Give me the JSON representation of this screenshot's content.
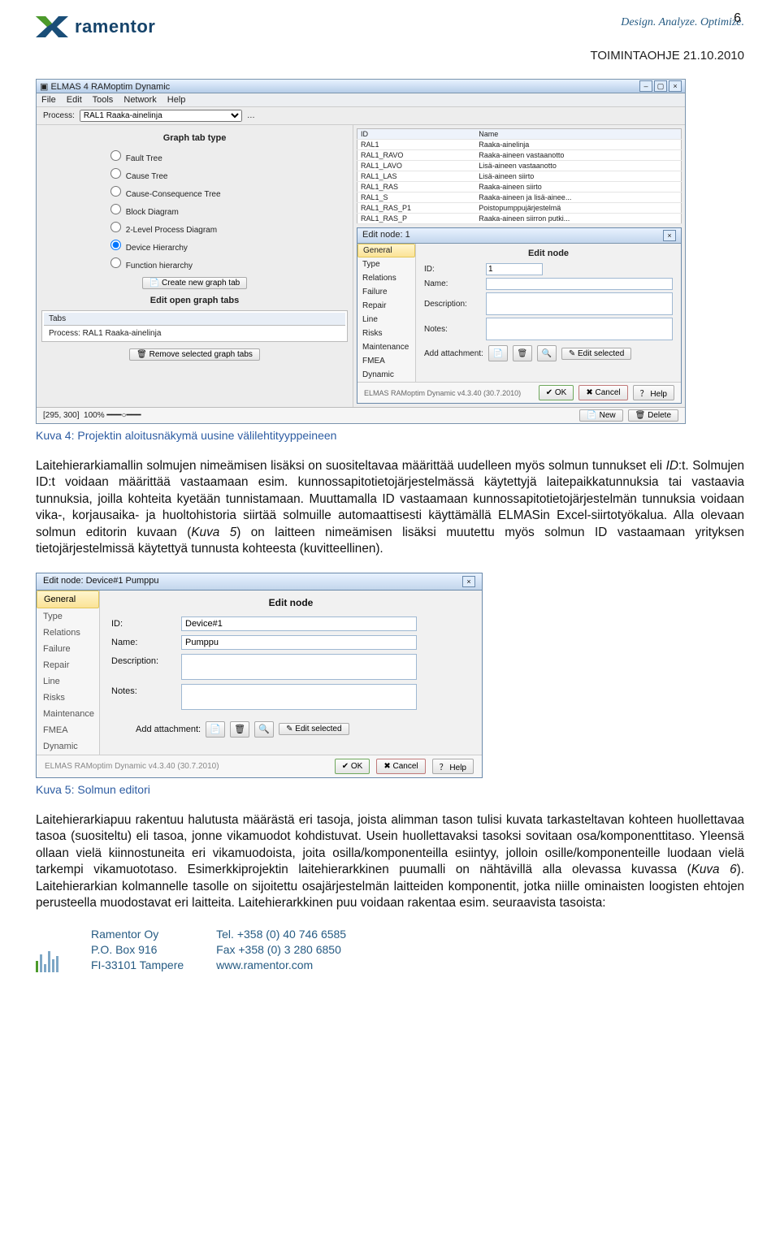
{
  "page_number": "6",
  "brand": {
    "name": "ramentor",
    "tagline": "Design. Analyze. Optimize."
  },
  "header_right": "TOIMINTAOHJE 21.10.2010",
  "app": {
    "title": "ELMAS 4 RAMoptim Dynamic",
    "menu": [
      "File",
      "Edit",
      "Tools",
      "Network",
      "Help"
    ],
    "process_label": "Process:",
    "process_value": "RAL1 Raaka-ainelinja",
    "graph_panel_title": "Graph tab type",
    "radios": [
      "Fault Tree",
      "Cause Tree",
      "Cause-Consequence Tree",
      "Block Diagram",
      "2-Level Process Diagram",
      "Device Hierarchy",
      "Function hierarchy"
    ],
    "radio_selected": 5,
    "create_tab_btn": "Create new graph tab",
    "edit_open_title": "Edit open graph tabs",
    "tabs_header": "Tabs",
    "tabs_row": "Process: RAL1 Raaka-ainelinja",
    "remove_tabs_btn": "Remove selected graph tabs",
    "id_table_headers": [
      "ID",
      "Name"
    ],
    "id_table_rows": [
      [
        "RAL1",
        "Raaka-ainelinja"
      ],
      [
        "RAL1_RAVO",
        "Raaka-aineen vastaanotto"
      ],
      [
        "RAL1_LAVO",
        "Lisä-aineen vastaanotto"
      ],
      [
        "RAL1_LAS",
        "Lisä-aineen siirto"
      ],
      [
        "RAL1_RAS",
        "Raaka-aineen siirto"
      ],
      [
        "RAL1_S",
        "Raaka-aineen ja lisä-ainee..."
      ],
      [
        "RAL1_RAS_P1",
        "Poistopumppujärjestelmä"
      ],
      [
        "RAL1_RAS_P",
        "Raaka-aineen siirron putki..."
      ]
    ],
    "edit_node": {
      "win_title": "Edit node: 1",
      "tabs": [
        "General",
        "Type",
        "Relations",
        "Failure",
        "Repair",
        "Line",
        "Risks",
        "Maintenance",
        "FMEA",
        "Dynamic"
      ],
      "heading": "Edit node",
      "id_label": "ID:",
      "id_val": "1",
      "name_label": "Name:",
      "desc_label": "Description:",
      "notes_label": "Notes:",
      "attach_label": "Add attachment:",
      "edit_selected": "Edit selected",
      "ver": "ELMAS RAMoptim Dynamic v4.3.40 (30.7.2010)",
      "ok": "OK",
      "cancel": "Cancel",
      "help": "Help"
    },
    "status_coord": "[295, 300]",
    "status_zoom": "100%",
    "status_new": "New",
    "status_delete": "Delete"
  },
  "caption1": "Kuva 4: Projektin aloitusnäkymä uusine välilehtityyppeineen",
  "para1": "Laitehierarkiamallin solmujen nimeämisen lisäksi on suositeltavaa määrittää uudelleen myös solmun tunnukset eli ID:t. Solmujen ID:t voidaan määrittää vastaamaan esim. kunnossapitotietojärjestelmässä käytettyjä laitepaikkatunnuksia tai vastaavia tunnuksia, joilla kohteita kyetään tunnistamaan. Muuttamalla ID vastaamaan kunnossapitotietojärjestelmän tunnuksia voidaan vika-, korjausaika- ja huoltohistoria siirtää solmuille automaattisesti käyttämällä ELMASin Excel-siirtotyökalua. Alla olevaan solmun editorin kuvaan (Kuva 5) on laitteen nimeämisen lisäksi muutettu myös solmun ID vastaamaan yrityksen tietojärjestelmissä käytettyä tunnusta kohteesta (kuvitteellinen).",
  "edit2": {
    "title": "Edit node: Device#1 Pumppu",
    "tabs": [
      "General",
      "Type",
      "Relations",
      "Failure",
      "Repair",
      "Line",
      "Risks",
      "Maintenance",
      "FMEA",
      "Dynamic"
    ],
    "heading": "Edit node",
    "id_label": "ID:",
    "id_val": "Device#1",
    "name_label": "Name:",
    "name_val": "Pumppu",
    "desc_label": "Description:",
    "notes_label": "Notes:",
    "attach_label": "Add attachment:",
    "edit_selected": "Edit selected",
    "ver": "ELMAS RAMoptim Dynamic v4.3.40 (30.7.2010)",
    "ok": "OK",
    "cancel": "Cancel",
    "help": "Help"
  },
  "caption2": "Kuva 5: Solmun editori",
  "para2": "Laitehierarkiapuu rakentuu halutusta määrästä eri tasoja, joista alimman tason tulisi kuvata tarkasteltavan kohteen huollettavaa tasoa (suositeltu) eli tasoa, jonne vikamuodot kohdistuvat. Usein huollettavaksi tasoksi sovitaan osa/komponenttitaso. Yleensä ollaan vielä kiinnostuneita eri vikamuodoista, joita osilla/komponenteilla esiintyy, jolloin osille/komponenteille luodaan vielä tarkempi vikamuototaso. Esimerkkiprojektin laitehierarkkinen puumalli on nähtävillä alla olevassa kuvassa (Kuva 6). Laitehierarkian kolmannelle tasolle on sijoitettu osajärjestelmän laitteiden komponentit, jotka niille ominaisten loogisten ehtojen perusteella muodostavat eri laitteita. Laitehierarkkinen puu voidaan rakentaa esim. seuraavista tasoista:",
  "footer": {
    "col1": [
      "Ramentor Oy",
      "P.O. Box 916",
      "FI-33101 Tampere"
    ],
    "col2": [
      "Tel. +358 (0) 40 746 6585",
      "Fax +358 (0) 3 280 6850",
      "www.ramentor.com"
    ]
  }
}
